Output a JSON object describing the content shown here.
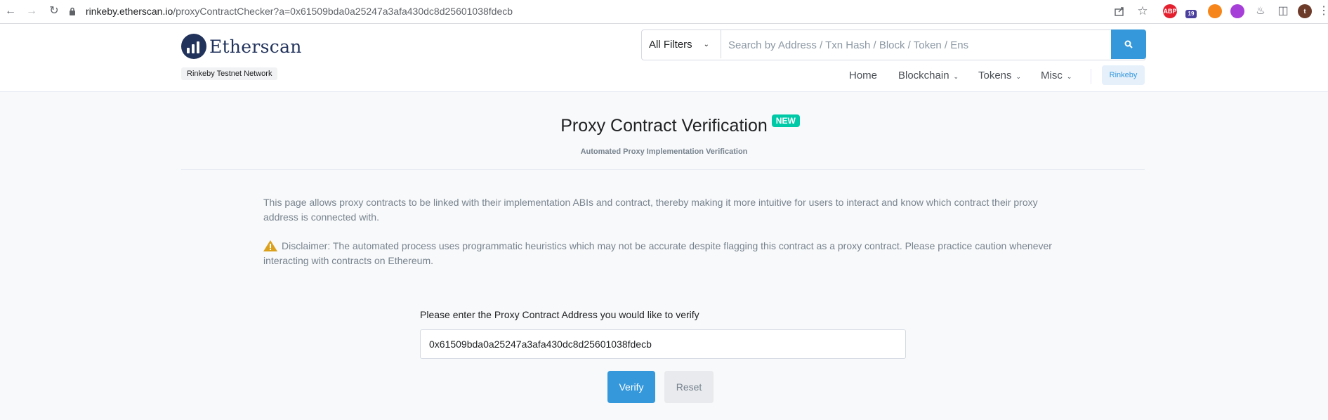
{
  "browser": {
    "url_host": "rinkeby.etherscan.io",
    "url_path": "/proxyContractChecker?a=0x61509bda0a25247a3afa430dc8d25601038fdecb",
    "extensions": [
      "ABP",
      "19",
      "t"
    ]
  },
  "header": {
    "logo_text": "Etherscan",
    "network_badge": "Rinkeby Testnet Network",
    "search": {
      "filter_label": "All Filters",
      "placeholder": "Search by Address / Txn Hash / Block / Token / Ens"
    },
    "menu": {
      "home": "Home",
      "blockchain": "Blockchain",
      "tokens": "Tokens",
      "misc": "Misc",
      "network_button": "Rinkeby"
    }
  },
  "main": {
    "title": "Proxy Contract Verification",
    "badge": "NEW",
    "subtitle": "Automated Proxy Implementation Verification",
    "intro": "This page allows proxy contracts to be linked with their implementation ABIs and contract, thereby making it more intuitive for users to interact and know which contract their proxy address is connected with.",
    "disclaimer": "Disclaimer: The automated process uses programmatic heuristics which may not be accurate despite flagging this contract as a proxy contract. Please practice caution whenever interacting with contracts on Ethereum.",
    "input_label": "Please enter the Proxy Contract Address you would like to verify",
    "input_value": "0x61509bda0a25247a3afa430dc8d25601038fdecb",
    "verify_label": "Verify",
    "reset_label": "Reset"
  },
  "colors": {
    "primary": "#3498db",
    "badge": "#00c9a7",
    "brand": "#21325b",
    "warning": "#dba01c"
  }
}
